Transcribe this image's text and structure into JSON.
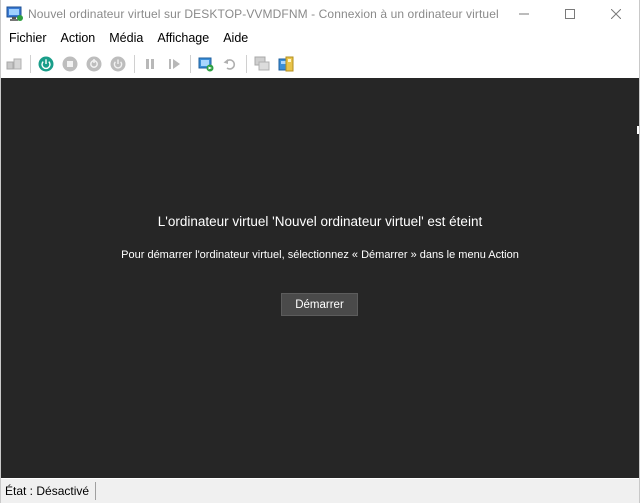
{
  "window": {
    "title": "Nouvel ordinateur virtuel sur DESKTOP-VVMDFNM - Connexion à un ordinateur virtuel",
    "title_icon": "vm-connect-icon",
    "controls": {
      "minimize_icon": "minimize-icon",
      "maximize_icon": "maximize-icon",
      "close_icon": "close-icon"
    }
  },
  "menu": {
    "items": [
      {
        "label": "Fichier"
      },
      {
        "label": "Action"
      },
      {
        "label": "Média"
      },
      {
        "label": "Affichage"
      },
      {
        "label": "Aide"
      }
    ]
  },
  "toolbar": {
    "buttons": [
      "ctrl-alt-del-icon",
      "start-icon",
      "turn-off-icon",
      "shut-down-icon",
      "save-icon",
      "pause-icon",
      "resume-icon",
      "checkpoint-icon",
      "revert-icon",
      "enhanced-session-icon",
      "share-icon"
    ]
  },
  "vm": {
    "heading": "L'ordinateur virtuel 'Nouvel ordinateur virtuel' est éteint",
    "instruction": "Pour démarrer l'ordinateur virtuel, sélectionnez « Démarrer » dans le menu Action",
    "start_button_label": "Démarrer"
  },
  "status": {
    "text": "État : Désactivé"
  },
  "colors": {
    "display_bg": "#262626",
    "start_button_bg": "#4a4a4a",
    "power_on_green": "#1a9e8a"
  }
}
